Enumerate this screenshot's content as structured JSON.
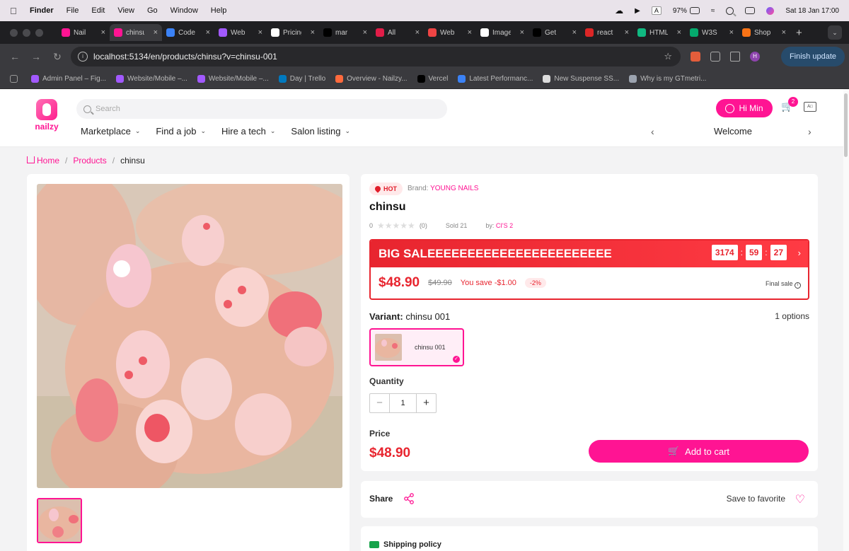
{
  "menubar": {
    "app": "Finder",
    "items": [
      "File",
      "Edit",
      "View",
      "Go",
      "Window",
      "Help"
    ],
    "input_source": "A",
    "battery": "97%",
    "datetime": "Sat 18 Jan  17:00"
  },
  "browser": {
    "tabs": [
      {
        "label": "Nail",
        "color": "#ff1493"
      },
      {
        "label": "chinsu",
        "color": "#ff1493",
        "active": true
      },
      {
        "label": "Code",
        "color": "#3b82f6"
      },
      {
        "label": "Web",
        "color": "#a259ff"
      },
      {
        "label": "Pricing",
        "color": "#ffffff"
      },
      {
        "label": "mar",
        "color": "#000000"
      },
      {
        "label": "All",
        "color": "#e11d48"
      },
      {
        "label": "Web",
        "color": "#ef4444"
      },
      {
        "label": "Images",
        "color": "#ffffff"
      },
      {
        "label": "Get",
        "color": "#000000"
      },
      {
        "label": "react",
        "color": "#dc2626"
      },
      {
        "label": "HTML",
        "color": "#10b981"
      },
      {
        "label": "W3S",
        "color": "#04aa6d"
      },
      {
        "label": "Shop",
        "color": "#f97316"
      }
    ],
    "url": "localhost:5134/en/products/chinsu?v=chinsu-001",
    "finish_update": "Finish update",
    "profile_initial": "H",
    "bookmarks": [
      "Admin Panel – Fig...",
      "Website/Mobile –...",
      "Website/Mobile –...",
      "Day | Trello",
      "Overview - Nailzy...",
      "Vercel",
      "Latest Performanc...",
      "New Suspense SS...",
      "Why is my GTmetri..."
    ]
  },
  "site": {
    "logo_text": "nailzy",
    "search_placeholder": "Search",
    "nav": [
      "Marketplace",
      "Find a job",
      "Hire a tech",
      "Salon listing"
    ],
    "user_button": "Hi Min",
    "cart_count": "2",
    "welcome": "Welcome",
    "accent": "#ff1493"
  },
  "breadcrumb": {
    "home": "Home",
    "products": "Products",
    "current": "chinsu"
  },
  "product": {
    "badge": "HOT",
    "brand_label": "Brand:",
    "brand": "YOUNG NAILS",
    "title": "chinsu",
    "rating_value": "0",
    "rating_count": "(0)",
    "sold": "Sold 21",
    "by_label": "by:",
    "seller": "CI'S 2",
    "sale": {
      "title": "BIG SALEEEEEEEEEEEEEEEEEEEEEEE",
      "timer": [
        "3174",
        "59",
        "27"
      ],
      "price": "$48.90",
      "old_price": "$49.90",
      "you_save": "You save -$1.00",
      "discount": "-2%",
      "final_sale": "Final sale"
    },
    "variant_label": "Variant:",
    "variant_value": "chinsu 001",
    "options_count": "1 options",
    "variant_card_label": "chinsu 001",
    "quantity_label": "Quantity",
    "quantity": "1",
    "price_label": "Price",
    "price": "$48.90",
    "add_to_cart": "Add to cart",
    "share": "Share",
    "save_favorite": "Save to favorite",
    "shipping_policy": "Shipping policy"
  }
}
